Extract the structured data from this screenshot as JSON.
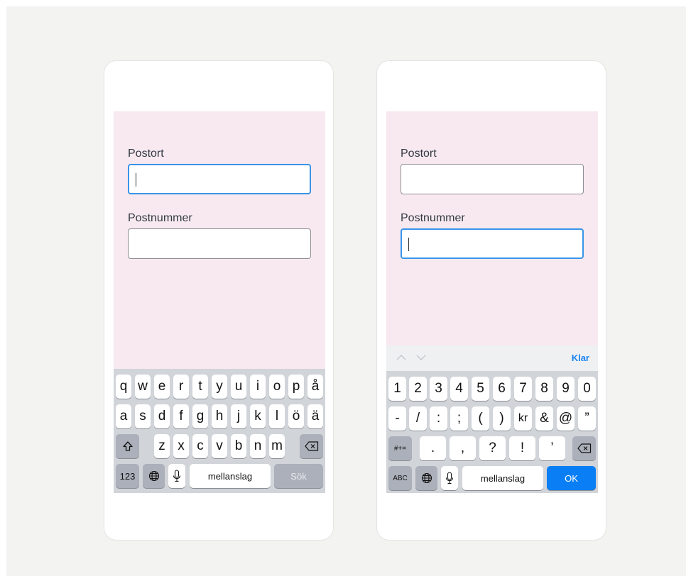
{
  "left_phone": {
    "fields": [
      {
        "label": "Postort",
        "value": ""
      },
      {
        "label": "Postnummer",
        "value": ""
      }
    ],
    "keyboard": {
      "row1": [
        "q",
        "w",
        "e",
        "r",
        "t",
        "y",
        "u",
        "i",
        "o",
        "p",
        "å"
      ],
      "row2": [
        "a",
        "s",
        "d",
        "f",
        "g",
        "h",
        "j",
        "k",
        "l",
        "ö",
        "ä"
      ],
      "row3": [
        "z",
        "x",
        "c",
        "v",
        "b",
        "n",
        "m"
      ],
      "numbers_key": "123",
      "space_key": "mellanslag",
      "return_key": "Sök"
    }
  },
  "right_phone": {
    "fields": [
      {
        "label": "Postort",
        "value": ""
      },
      {
        "label": "Postnummer",
        "value": ""
      }
    ],
    "accessory": {
      "done_label": "Klar"
    },
    "keyboard": {
      "row1": [
        "1",
        "2",
        "3",
        "4",
        "5",
        "6",
        "7",
        "8",
        "9",
        "0"
      ],
      "row2": [
        "-",
        "/",
        ":",
        ";",
        "(",
        ")",
        "kr",
        "&",
        "@",
        "”"
      ],
      "row3": [
        ".",
        ",",
        "?",
        "!",
        "’"
      ],
      "symbols_key": "#+=",
      "letters_key": "ABC",
      "space_key": "mellanslag",
      "return_key": "OK"
    }
  },
  "colors": {
    "screen_bg": "#f7e9ef",
    "focus_border": "#3a94e8",
    "ok_key": "#0a7ff5"
  }
}
